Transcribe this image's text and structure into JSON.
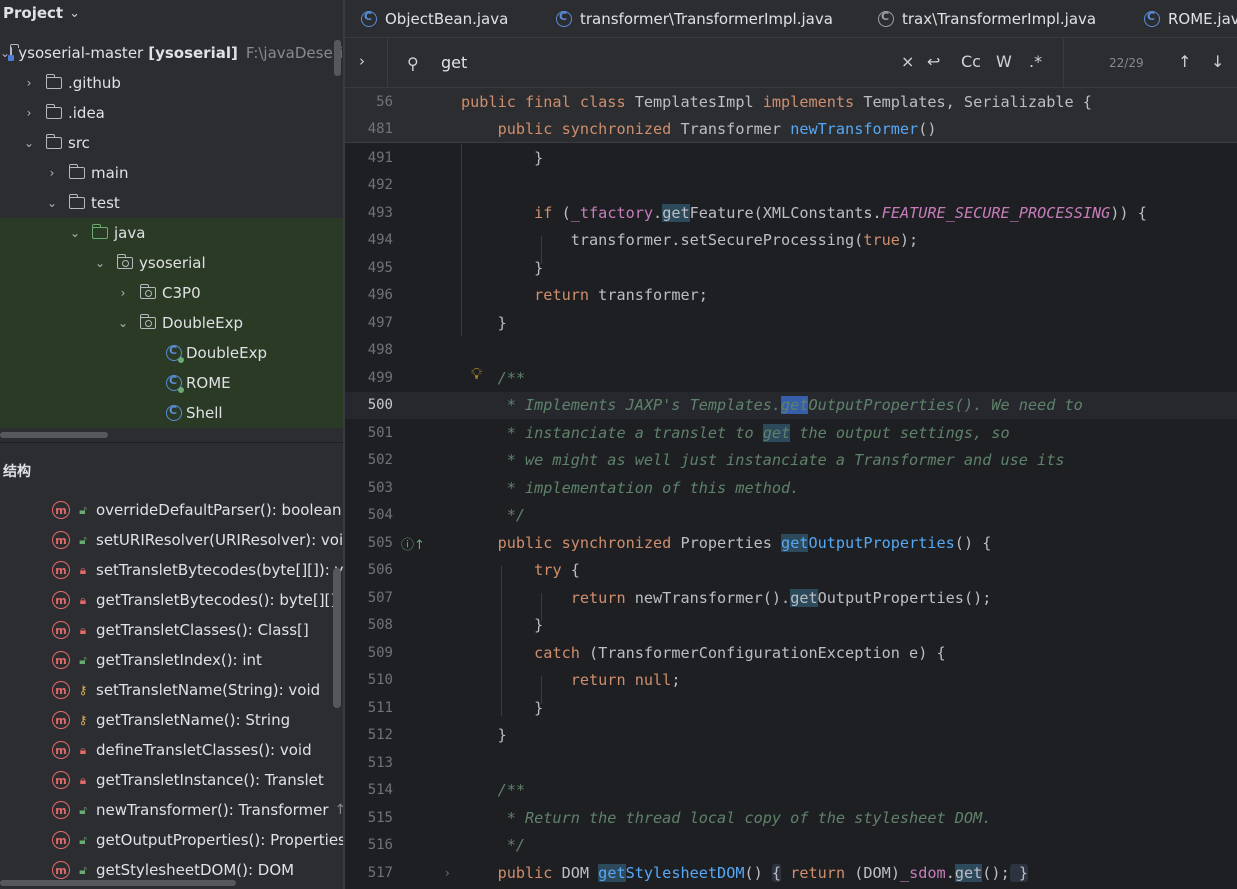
{
  "project": {
    "title": "Project",
    "tree": [
      {
        "label": "ysoserial-master",
        "module": "[ysoserial]",
        "path": "F:\\javaDeseri"
      },
      {
        "label": ".github"
      },
      {
        "label": ".idea"
      },
      {
        "label": "src"
      },
      {
        "label": "main"
      },
      {
        "label": "test"
      },
      {
        "label": "java"
      },
      {
        "label": "ysoserial"
      },
      {
        "label": "C3P0"
      },
      {
        "label": "DoubleExp"
      },
      {
        "label": "DoubleExp"
      },
      {
        "label": "ROME"
      },
      {
        "label": "Shell"
      }
    ]
  },
  "structure": {
    "title": "结构",
    "members": [
      {
        "label": "overrideDefaultParser(): boolean",
        "access": "public"
      },
      {
        "label": "setURIResolver(URIResolver): void",
        "access": "public"
      },
      {
        "label": "setTransletBytecodes(byte[][]): voi",
        "access": "private"
      },
      {
        "label": "getTransletBytecodes(): byte[][]",
        "access": "private"
      },
      {
        "label": "getTransletClasses(): Class[]",
        "access": "private"
      },
      {
        "label": "getTransletIndex(): int",
        "access": "public"
      },
      {
        "label": "setTransletName(String): void",
        "access": "protected"
      },
      {
        "label": "getTransletName(): String",
        "access": "protected"
      },
      {
        "label": "defineTransletClasses(): void",
        "access": "private"
      },
      {
        "label": "getTransletInstance(): Translet",
        "access": "private"
      },
      {
        "label": "newTransformer(): Transformer",
        "access": "public",
        "extra": "↑T"
      },
      {
        "label": "getOutputProperties(): Properties",
        "access": "public"
      },
      {
        "label": "getStylesheetDOM(): DOM",
        "access": "public"
      }
    ]
  },
  "tabs": [
    {
      "label": "ObjectBean.java"
    },
    {
      "label": "transformer\\TransformerImpl.java"
    },
    {
      "label": "trax\\TransformerImpl.java"
    },
    {
      "label": "ROME.java"
    }
  ],
  "search": {
    "query": "get",
    "match_case_label": "Cc",
    "words_label": "W",
    "regex_label": ".*",
    "match_count": "22/29"
  },
  "editor": {
    "sticky_lines": [
      {
        "num": "56",
        "text": "public final class TemplatesImpl implements Templates, Serializable {"
      },
      {
        "num": "481",
        "text": "public synchronized Transformer newTransformer()"
      }
    ],
    "lines": [
      {
        "num": "491",
        "text": "        }"
      },
      {
        "num": "492",
        "text": ""
      },
      {
        "num": "493",
        "text": "        if (_tfactory.getFeature(XMLConstants.FEATURE_SECURE_PROCESSING)) {"
      },
      {
        "num": "494",
        "text": "            transformer.setSecureProcessing(true);"
      },
      {
        "num": "495",
        "text": "        }"
      },
      {
        "num": "496",
        "text": "        return transformer;"
      },
      {
        "num": "497",
        "text": "    }"
      },
      {
        "num": "498",
        "text": ""
      },
      {
        "num": "499",
        "text": "    /**"
      },
      {
        "num": "500",
        "text": "     * Implements JAXP's Templates.getOutputProperties(). We need to"
      },
      {
        "num": "501",
        "text": "     * instanciate a translet to get the output settings, so"
      },
      {
        "num": "502",
        "text": "     * we might as well just instanciate a Transformer and use its"
      },
      {
        "num": "503",
        "text": "     * implementation of this method."
      },
      {
        "num": "504",
        "text": "     */"
      },
      {
        "num": "505",
        "text": "    public synchronized Properties getOutputProperties() {"
      },
      {
        "num": "506",
        "text": "        try {"
      },
      {
        "num": "507",
        "text": "            return newTransformer().getOutputProperties();"
      },
      {
        "num": "508",
        "text": "        }"
      },
      {
        "num": "509",
        "text": "        catch (TransformerConfigurationException e) {"
      },
      {
        "num": "510",
        "text": "            return null;"
      },
      {
        "num": "511",
        "text": "        }"
      },
      {
        "num": "512",
        "text": "    }"
      },
      {
        "num": "513",
        "text": ""
      },
      {
        "num": "514",
        "text": "    /**"
      },
      {
        "num": "515",
        "text": "     * Return the thread local copy of the stylesheet DOM."
      },
      {
        "num": "516",
        "text": "     */"
      },
      {
        "num": "517",
        "text": "    public DOM getStylesheetDOM() { return (DOM)_sdom.get(); }"
      }
    ]
  },
  "colors": {
    "keyword": "#cf8e6d",
    "function": "#56a8f5",
    "comment": "#5f826b",
    "constant": "#c77dbb",
    "search_match": "#2c4a5c",
    "current_match": "#375ea8"
  }
}
